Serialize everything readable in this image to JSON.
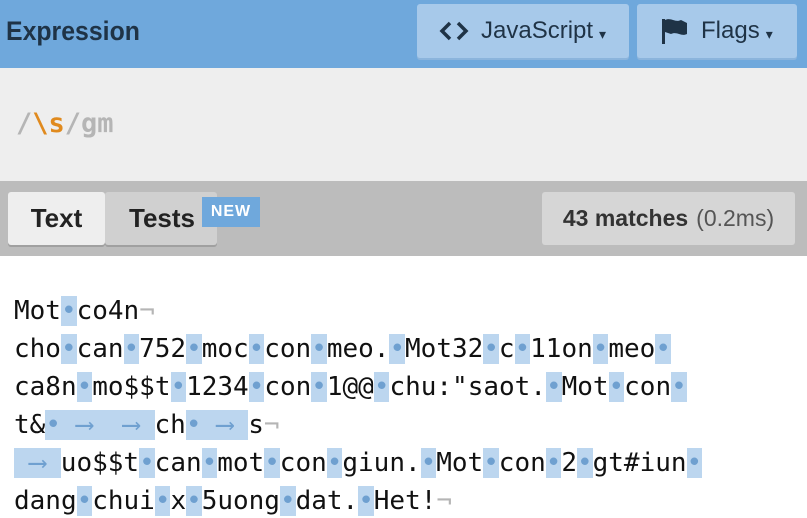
{
  "header": {
    "title": "Expression",
    "language_label": "JavaScript",
    "flags_label": "Flags",
    "caret": "▾"
  },
  "expression": {
    "open": "/",
    "pattern": "\\s",
    "close": "/",
    "flags": "gm"
  },
  "tabs": {
    "text": "Text",
    "tests": "Tests",
    "tests_badge": "NEW"
  },
  "status": {
    "matches": "43 matches",
    "time": "(0.2ms)"
  },
  "symbols": {
    "space": "•",
    "tab": "⟶",
    "eol": "¬"
  },
  "text_lines": [
    "Mot co4n\n",
    "cho can 752 moc con meo. Mot32 c 11on meo ",
    "ca8n mo$$t 1234 con 1@@ chu:\"saot. Mot con ",
    "t& \t\tch \ts\n",
    "\tuo$$t can mot con giun. Mot con 2 gt#iun ",
    "dang chui x 5uong dat. Het!\n"
  ],
  "colors": {
    "header_bg": "#6fa8dc",
    "match_highlight": "#bcd6ef",
    "escape_orange": "#e08a1e"
  }
}
